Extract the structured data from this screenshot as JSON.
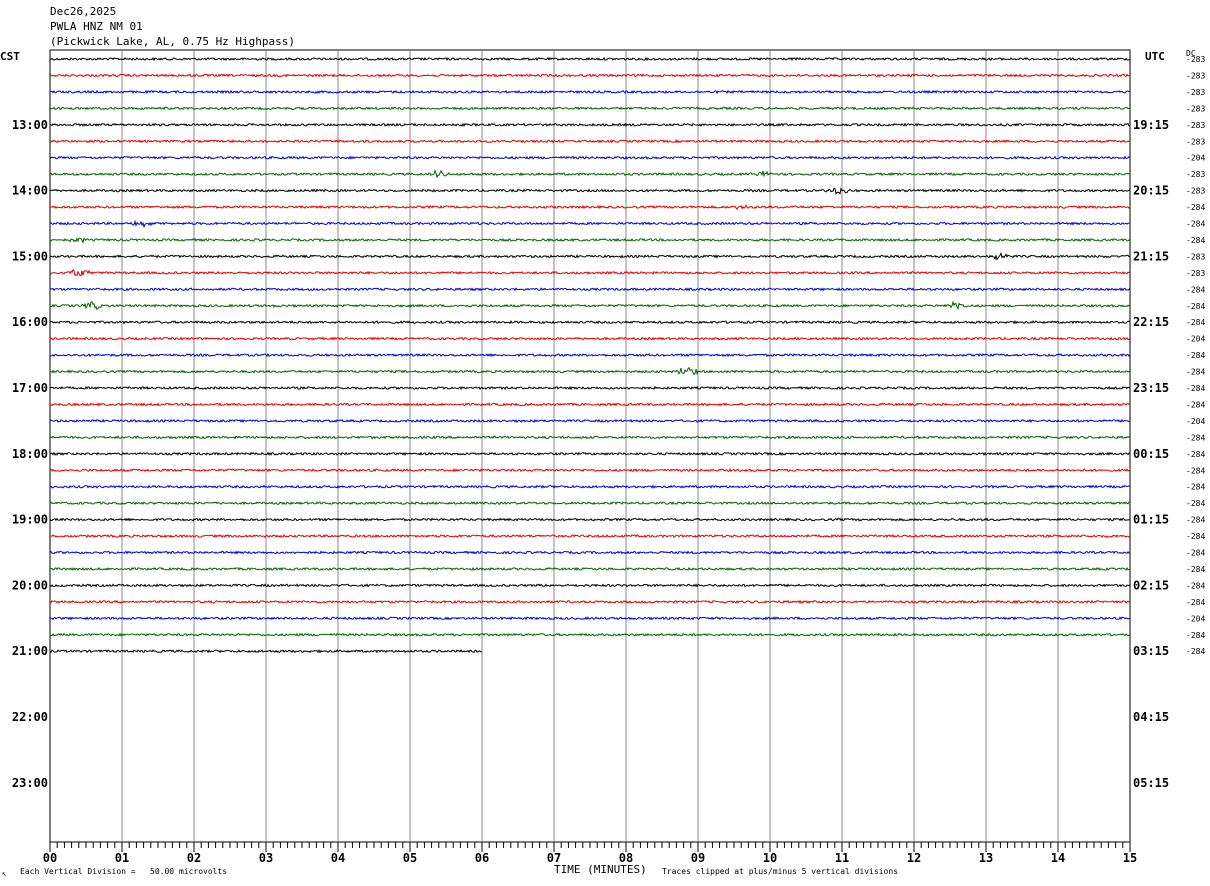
{
  "header": {
    "date": "Dec26,2025",
    "station": "PWLA HNZ NM 01",
    "location": "(Pickwick Lake, AL, 0.75 Hz Highpass)"
  },
  "zones": {
    "left": "CST",
    "right": "UTC",
    "dc": "DC"
  },
  "footer": {
    "mark": "↖",
    "scale": "Each Vertical Division =   50.00 microvolts",
    "xlabel": "TIME (MINUTES)",
    "clip": "Traces clipped at plus/minus 5 vertical divisions"
  },
  "chart_data": {
    "type": "line",
    "title": "PWLA HNZ NM 01",
    "xlabel": "TIME (MINUTES)",
    "xlim": [
      0,
      15
    ],
    "x_ticks": [
      "00",
      "01",
      "02",
      "03",
      "04",
      "05",
      "06",
      "07",
      "08",
      "09",
      "10",
      "11",
      "12",
      "13",
      "14",
      "15"
    ],
    "left_hour_labels": [
      "13:00",
      "14:00",
      "15:00",
      "16:00",
      "17:00",
      "18:00",
      "19:00",
      "20:00",
      "21:00",
      "22:00",
      "23:00"
    ],
    "right_hour_labels": [
      "19:15",
      "20:15",
      "21:15",
      "22:15",
      "23:15",
      "00:15",
      "01:15",
      "02:15",
      "03:15",
      "04:15",
      "05:15"
    ],
    "trace_colors": [
      "#000000",
      "#dd0000",
      "#0000cc",
      "#006600"
    ],
    "traces_count": 37,
    "last_trace_end_minute": 6,
    "dc_offsets": [
      "-283",
      "-283",
      "-283",
      "-283",
      "-283",
      "-283",
      "-204",
      "-283",
      "-283",
      "-284",
      "-284",
      "-284",
      "-283",
      "-283",
      "-284",
      "-284",
      "-284",
      "-204",
      "-284",
      "-284",
      "-284",
      "-284",
      "-204",
      "-284",
      "-284",
      "-284",
      "-284",
      "-284",
      "-284",
      "-284",
      "-284",
      "-284",
      "-284",
      "-284",
      "-204",
      "-284",
      "-284"
    ],
    "events": [
      {
        "trace": 7,
        "minute": 5.4,
        "amp": 4
      },
      {
        "trace": 7,
        "minute": 9.9,
        "amp": 3
      },
      {
        "trace": 8,
        "minute": 10.95,
        "amp": 4
      },
      {
        "trace": 9,
        "minute": 9.6,
        "amp": 2
      },
      {
        "trace": 10,
        "minute": 1.3,
        "amp": 3
      },
      {
        "trace": 11,
        "minute": 0.4,
        "amp": 3
      },
      {
        "trace": 12,
        "minute": 13.2,
        "amp": 4
      },
      {
        "trace": 13,
        "minute": 0.4,
        "amp": 5
      },
      {
        "trace": 15,
        "minute": 0.6,
        "amp": 4
      },
      {
        "trace": 15,
        "minute": 12.6,
        "amp": 4
      },
      {
        "trace": 19,
        "minute": 8.85,
        "amp": 5
      }
    ]
  }
}
